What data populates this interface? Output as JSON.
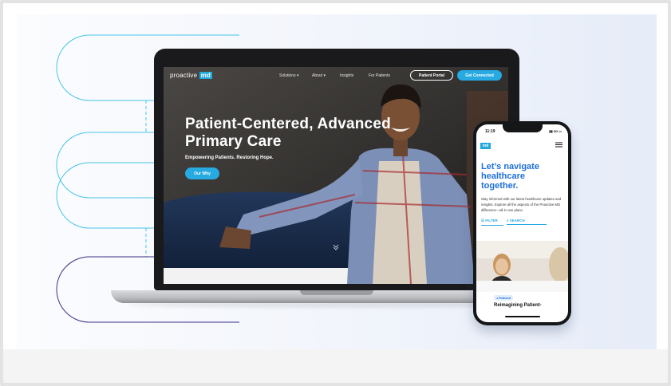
{
  "colors": {
    "accent": "#27a9e1",
    "phone_heading": "#1e6fd9",
    "decor_line_cyan": "#49c6e8",
    "decor_line_purple": "#3b2f86"
  },
  "site": {
    "logo_text": "proactive",
    "logo_badge": "md",
    "nav": {
      "solutions": "Solutions ▾",
      "about": "About ▾",
      "insights": "Insights",
      "for_patients": "For Patients"
    },
    "patient_portal_button": "Patient Portal",
    "get_connected_button": "Get Connected",
    "hero": {
      "title": "Patient-Centered, Advanced Primary Care",
      "subtitle": "Empowering Patients. Restoring Hope.",
      "cta": "Our Why"
    },
    "scroll_icon": "chevron-down-icon"
  },
  "phone": {
    "time": "11:19",
    "status_right": "▮▮ 5G ▭",
    "badge": "md",
    "menu_icon": "hamburger-icon",
    "title": "Let’s navigate healthcare together.",
    "body": "Stay informed with our latest healthcare updates and insights. Explore all the aspects of the Proactive MD difference—all in one place.",
    "filter_label": "☰ FILTER",
    "search_label": "⌕ SEARCH",
    "featured_label": "● Featured",
    "featured_title": "Reimagining Patient-"
  }
}
